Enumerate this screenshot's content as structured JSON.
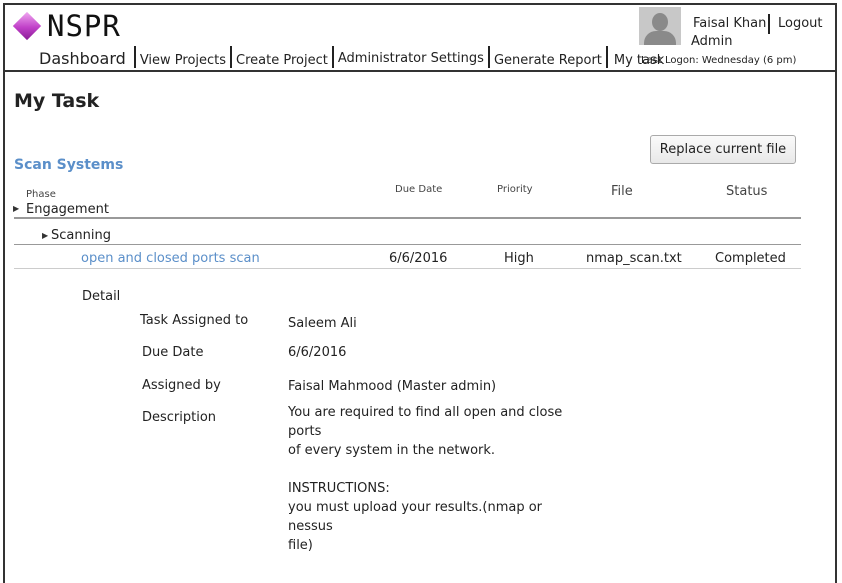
{
  "app": {
    "logo_text": "NSPR"
  },
  "nav": {
    "items": [
      "Dashboard",
      "View Projects",
      "Create Project",
      "Administrator Settings",
      "Generate Report",
      "My task"
    ]
  },
  "user": {
    "name": "Faisal Khan",
    "logout_label": "Logout",
    "role": "Admin",
    "last_logon": "Last Logon:  Wednesday (6 pm)"
  },
  "page": {
    "title": "My Task",
    "replace_button": "Replace current file",
    "section_title": "Scan Systems"
  },
  "table": {
    "headers": {
      "phase": "Phase",
      "due_date": "Due Date",
      "priority": "Priority",
      "file": "File",
      "status": "Status"
    },
    "phase_name": "Engagement",
    "subphase_name": "Scanning",
    "task": {
      "name": "open and closed ports scan",
      "due_date": "6/6/2016",
      "priority": "High",
      "file": "nmap_scan.txt",
      "status": "Completed"
    }
  },
  "detail": {
    "label": "Detail",
    "fields": {
      "assigned_to_label": "Task Assigned to",
      "assigned_to_value": "Saleem Ali",
      "due_date_label": "Due Date",
      "due_date_value": "6/6/2016",
      "assigned_by_label": "Assigned by",
      "assigned_by_value": "Faisal Mahmood (Master admin)",
      "description_label": "Description"
    },
    "description": {
      "line1": "You are required to find all open and close ports",
      "line2": "of every system in the network.",
      "instructions_heading": "INSTRUCTIONS:",
      "instructions_line1": "you must upload your results.(nmap or nessus",
      "instructions_line2": "file)"
    }
  },
  "colors": {
    "link": "#5b8fc9",
    "logo_diamond": "#c040c8",
    "border": "#333333"
  },
  "icons": {
    "logo": "diamond-logo-icon",
    "avatar": "user-avatar-icon",
    "expand": "caret-right-icon"
  }
}
